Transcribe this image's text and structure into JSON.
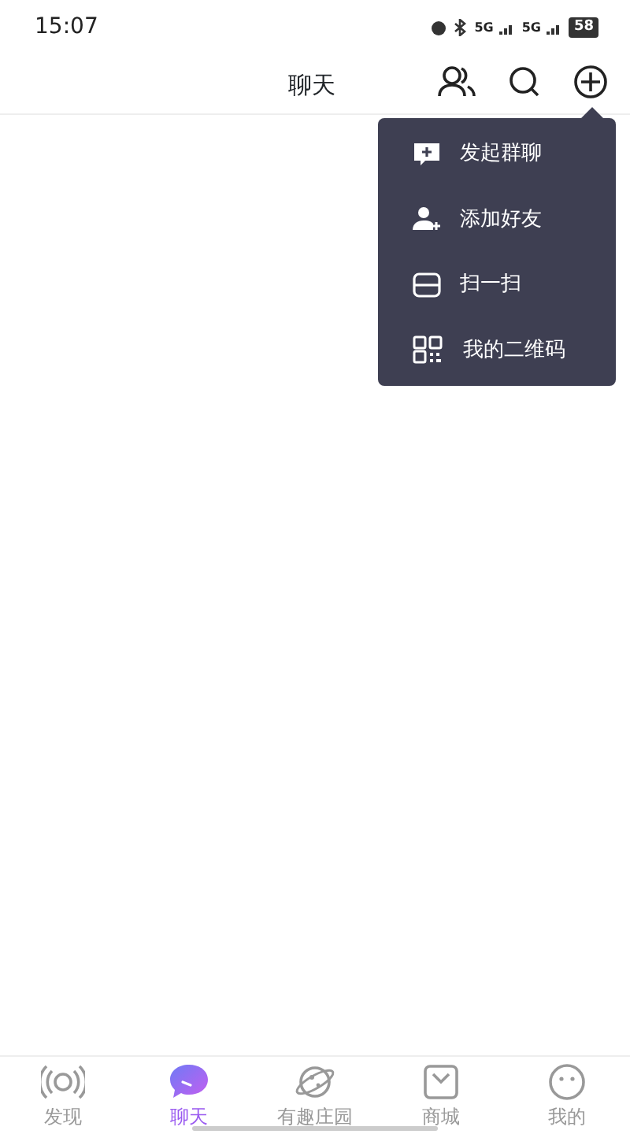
{
  "status_bar": {
    "time": "15:07",
    "network_1": "5G",
    "network_2": "5G",
    "battery": "58"
  },
  "header": {
    "title": "聊天"
  },
  "menu": {
    "items": [
      {
        "label": "发起群聊",
        "kind": "group-chat"
      },
      {
        "label": "添加好友",
        "kind": "add-friend"
      },
      {
        "label": "扫一扫",
        "kind": "scan"
      },
      {
        "label": "我的二维码",
        "kind": "qr-code"
      }
    ]
  },
  "bottom_nav": [
    {
      "label": "发现",
      "kind": "discover",
      "selected": false
    },
    {
      "label": "聊天",
      "kind": "chat",
      "selected": true
    },
    {
      "label": "有趣庄园",
      "kind": "planet",
      "selected": false
    },
    {
      "label": "商城",
      "kind": "shop",
      "selected": false
    },
    {
      "label": "我的",
      "kind": "me",
      "selected": false
    }
  ]
}
